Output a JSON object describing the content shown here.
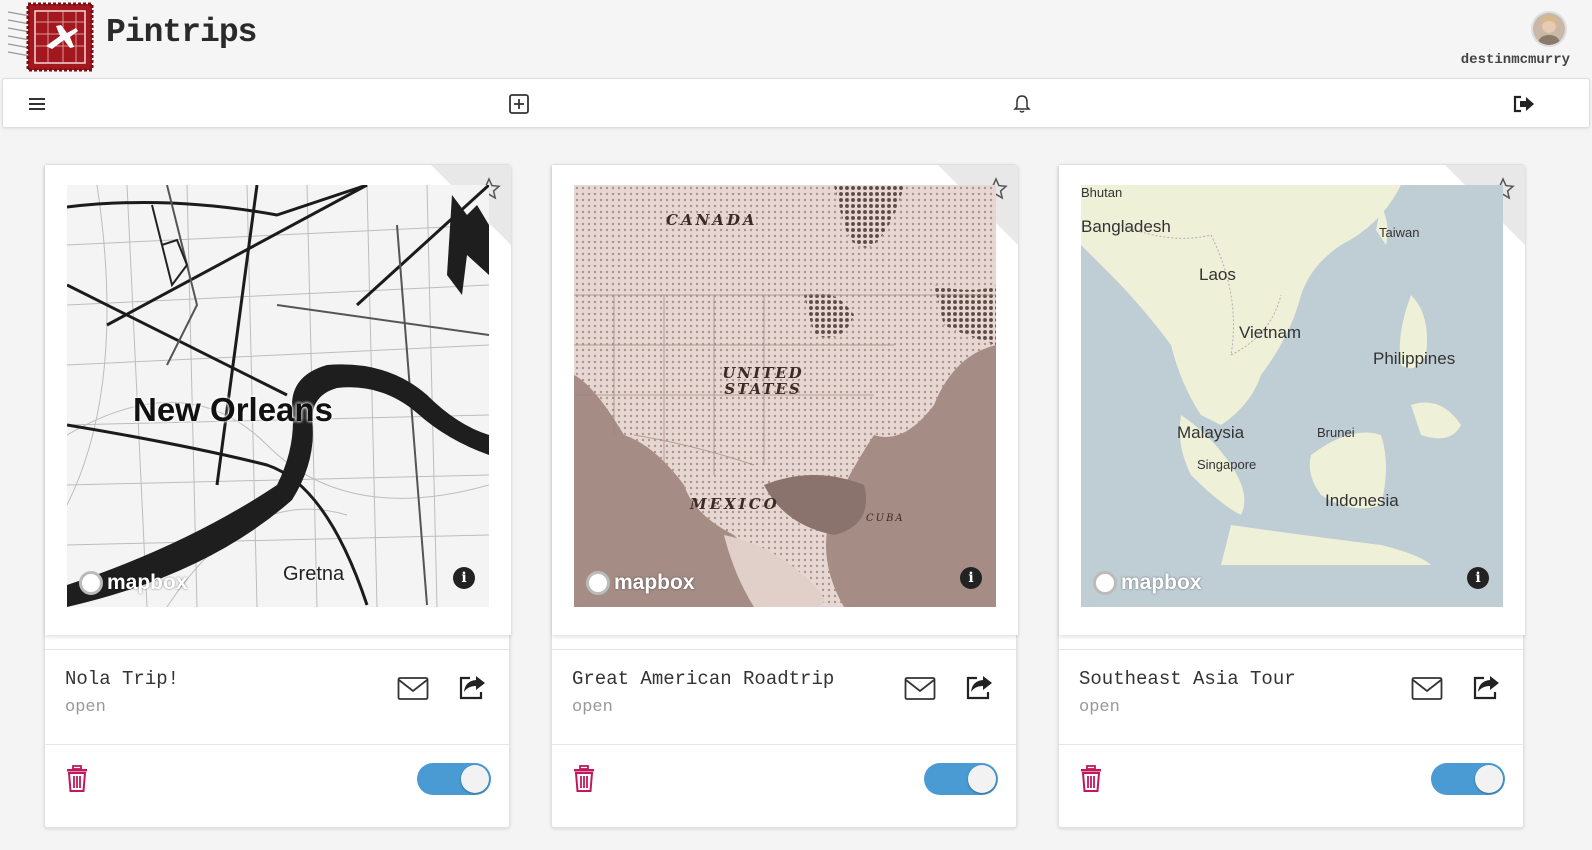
{
  "app": {
    "brand": "Pintrips",
    "username": "destinmcmurry"
  },
  "toolbar": {
    "menu_icon": "hamburger-menu-icon",
    "add_icon": "plus-square-icon",
    "notifications_icon": "bell-icon",
    "logout_icon": "sign-out-icon"
  },
  "colors": {
    "toggle_on": "#4a9bd3",
    "trash": "#c2185b",
    "star": "#555555"
  },
  "trips": [
    {
      "title": "Nola Trip!",
      "status": "open",
      "favorite": false,
      "enabled": true,
      "map": {
        "style": "light-monochrome",
        "attribution": "mapbox",
        "labels": [
          "New Orleans",
          "Gretna"
        ]
      }
    },
    {
      "title": "Great American Roadtrip",
      "status": "open",
      "favorite": false,
      "enabled": true,
      "map": {
        "style": "vintage-halftone",
        "attribution": "mapbox",
        "labels": [
          "CANADA",
          "UNITED STATES",
          "MEXICO",
          "CUBA"
        ]
      }
    },
    {
      "title": "Southeast Asia Tour",
      "status": "open",
      "favorite": false,
      "enabled": true,
      "map": {
        "style": "streets",
        "attribution": "mapbox",
        "labels": [
          "Bhutan",
          "Bangladesh",
          "Taiwan",
          "Laos",
          "Vietnam",
          "Philippines",
          "Malaysia",
          "Brunei",
          "Singapore",
          "Indonesia"
        ]
      }
    }
  ]
}
